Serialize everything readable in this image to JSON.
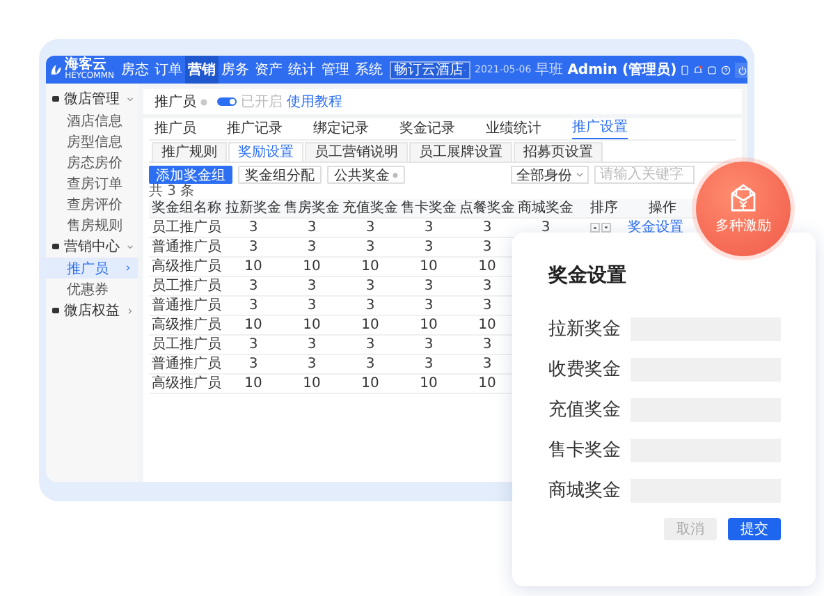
{
  "app": {
    "logo": "海客云",
    "logo_sub": "HEYCOMMN",
    "nav": [
      {
        "label": "房态",
        "selected": false
      },
      {
        "label": "订单",
        "selected": false
      },
      {
        "label": "营销",
        "selected": true
      },
      {
        "label": "房务",
        "selected": false
      },
      {
        "label": "资产",
        "selected": false
      },
      {
        "label": "统计",
        "selected": false
      },
      {
        "label": "管理",
        "selected": false
      },
      {
        "label": "系统",
        "selected": false
      }
    ],
    "hotel_select": "畅订云酒店",
    "date": "2021-05-06",
    "shift": "早班",
    "user": "Admin (管理员)"
  },
  "sidebar": [
    {
      "label": "微店管理",
      "expanded": true,
      "children": [
        {
          "label": "酒店信息",
          "selected": false
        },
        {
          "label": "房型信息",
          "selected": false
        },
        {
          "label": "房态房价",
          "selected": false
        },
        {
          "label": "查房订单",
          "selected": false
        },
        {
          "label": "查房评价",
          "selected": false
        },
        {
          "label": "售房规则",
          "selected": false
        }
      ]
    },
    {
      "label": "营销中心",
      "expanded": true,
      "children": [
        {
          "label": "推广员",
          "selected": true
        },
        {
          "label": "优惠券",
          "selected": false
        }
      ]
    },
    {
      "label": "微店权益",
      "expanded": false
    }
  ],
  "page": {
    "title": "推广员",
    "toggle_on": true,
    "toggle_label": "已开启",
    "help_link": "使用教程",
    "tabs": [
      {
        "label": "推广员",
        "selected": false
      },
      {
        "label": "推广记录",
        "selected": false
      },
      {
        "label": "绑定记录",
        "selected": false
      },
      {
        "label": "奖金记录",
        "selected": false
      },
      {
        "label": "业绩统计",
        "selected": false
      },
      {
        "label": "推广设置",
        "selected": true
      }
    ],
    "subtabs": [
      {
        "label": "推广规则",
        "selected": false
      },
      {
        "label": "奖励设置",
        "selected": true
      },
      {
        "label": "员工营销说明",
        "selected": false
      },
      {
        "label": "员工展牌设置",
        "selected": false
      },
      {
        "label": "招募页设置",
        "selected": false
      }
    ],
    "buttons": [
      {
        "label": "添加奖金组",
        "kind": "primary"
      },
      {
        "label": "奖金组分配",
        "kind": "plain"
      },
      {
        "label": "公共奖金",
        "kind": "info"
      }
    ],
    "filter_select": "全部身份",
    "search": {
      "placeholder": "请输入关键字"
    },
    "total": "共 3 条",
    "table": {
      "columns": [
        "奖金组名称",
        "拉新奖金",
        "售房奖金",
        "充值奖金",
        "售卡奖金",
        "点餐奖金",
        "商城奖金",
        "排序",
        "操作"
      ],
      "rows": [
        {
          "cells": [
            "员工推广员",
            "3",
            "3",
            "3",
            "3",
            "3",
            "3"
          ],
          "actions": [
            "奖金设置"
          ]
        },
        {
          "cells": [
            "普通推广员",
            "3",
            "3",
            "3",
            "3",
            "3"
          ]
        },
        {
          "cells": [
            "高级推广员",
            "10",
            "10",
            "10",
            "10",
            "10"
          ]
        },
        {
          "cells": [
            "员工推广员",
            "3",
            "3",
            "3",
            "3",
            "3"
          ]
        },
        {
          "cells": [
            "普通推广员",
            "3",
            "3",
            "3",
            "3",
            "3"
          ]
        },
        {
          "cells": [
            "高级推广员",
            "10",
            "10",
            "10",
            "10",
            "10"
          ]
        },
        {
          "cells": [
            "员工推广员",
            "3",
            "3",
            "3",
            "3",
            "3"
          ]
        },
        {
          "cells": [
            "普通推广员",
            "3",
            "3",
            "3",
            "3",
            "3"
          ]
        },
        {
          "cells": [
            "高级推广员",
            "10",
            "10",
            "10",
            "10",
            "10"
          ]
        }
      ]
    }
  },
  "dialog": {
    "title": "奖金设置",
    "fields": [
      {
        "label": "拉新奖金"
      },
      {
        "label": "收费奖金"
      },
      {
        "label": "充值奖金"
      },
      {
        "label": "售卡奖金"
      },
      {
        "label": "商城奖金"
      }
    ],
    "cancel": "取消",
    "cancel_disabled": true,
    "submit": "提交"
  },
  "badge": {
    "label": "多种激励"
  }
}
